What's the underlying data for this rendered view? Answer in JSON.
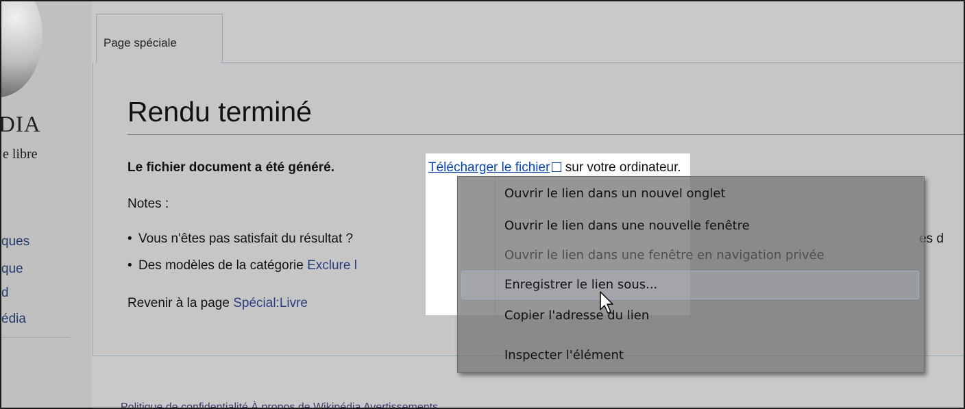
{
  "sidebar": {
    "wordmark": "DIA",
    "tagline": "e libre",
    "nav_items": [
      "ques",
      "que",
      "d",
      "édia"
    ]
  },
  "tab": {
    "label": "Page spéciale"
  },
  "content": {
    "title": "Rendu terminé",
    "line1_bold": "Le fichier document a été généré.",
    "download_link": "Télécharger le fichier",
    "line1_suffix": "sur votre ordinateur.",
    "notes_label": "Notes :",
    "bullet1": "Vous n'êtes pas satisfait du résultat ?",
    "bullet1_trail": "es d",
    "bullet2_prefix": "Des modèles de la catégorie",
    "bullet2_link": "Exclure l",
    "return_prefix": "Revenir à la page",
    "return_link": "Spécial:Livre"
  },
  "context_menu": {
    "items": [
      {
        "label": "Ouvrir le lien dans un nouvel onglet",
        "enabled": true
      },
      {
        "label": "Ouvrir le lien dans une nouvelle fenêtre",
        "enabled": true
      },
      {
        "label": "Ouvrir le lien dans une fenêtre en navigation privée",
        "enabled": false
      },
      {
        "label": "Enregistrer le lien sous...",
        "enabled": true,
        "hovered": true
      },
      {
        "label": "Copier l'adresse du lien",
        "enabled": true
      },
      {
        "label": "Inspecter l'élément",
        "enabled": true
      }
    ]
  },
  "footer": {
    "text": "Politique de confidentialité   À propos de Wikipédia   Avertissements"
  }
}
